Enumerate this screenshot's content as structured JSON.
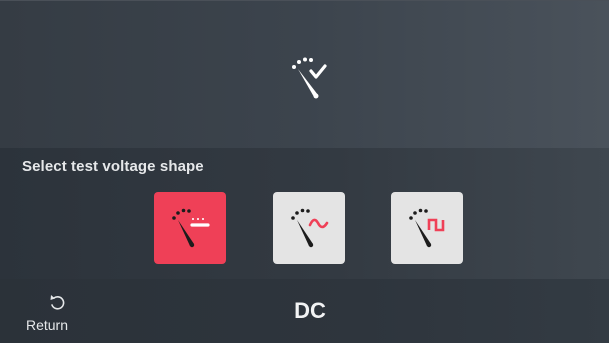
{
  "header": {
    "icon": "voltage-meter-check-icon"
  },
  "selection": {
    "label": "Select test voltage shape",
    "options": [
      {
        "id": "dc",
        "icon": "voltage-meter-dc-icon",
        "selected": true
      },
      {
        "id": "ac",
        "icon": "voltage-meter-ac-icon",
        "selected": false
      },
      {
        "id": "pulse",
        "icon": "voltage-meter-pulse-icon",
        "selected": false
      }
    ]
  },
  "footer": {
    "return_label": "Return",
    "return_icon": "return-arrow-icon",
    "mode_label": "DC"
  },
  "colors": {
    "accent": "#ef4057",
    "button_bg": "#e4e4e4",
    "text": "#e6e8ea",
    "background": "#2f363e"
  }
}
